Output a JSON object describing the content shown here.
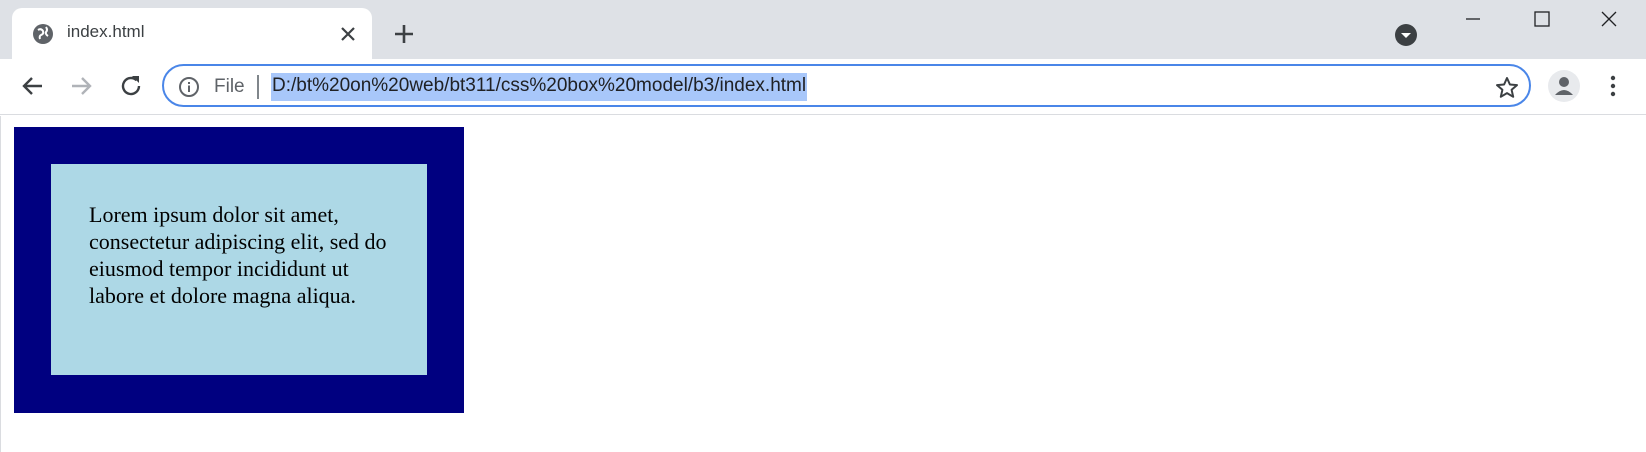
{
  "tab": {
    "title": "index.html",
    "favicon": "globe-icon",
    "close_icon": "close-icon"
  },
  "tabstrip": {
    "new_tab_icon": "plus-icon",
    "search_tabs_icon": "chevron-down-circle-icon"
  },
  "window_controls": {
    "minimize_icon": "minimize-icon",
    "maximize_icon": "maximize-icon",
    "close_icon": "close-icon"
  },
  "toolbar": {
    "back_icon": "arrow-left-icon",
    "forward_icon": "arrow-right-icon",
    "reload_icon": "reload-icon",
    "bookmark_icon": "star-icon",
    "profile_icon": "person-icon",
    "menu_icon": "kebab-menu-icon"
  },
  "omnibox": {
    "scheme_label": "File",
    "url": "D:/bt%20on%20web/bt311/css%20box%20model/b3/index.html",
    "info_icon": "info-icon"
  },
  "page": {
    "paragraph": "Lorem ipsum dolor sit amet, consectetur adipiscing elit, sed do eiusmod tempor incididunt ut labore et dolore magna aliqua."
  },
  "colors": {
    "outer_box": "#000080",
    "inner_box": "#add8e6",
    "url_highlight": "#a8c7fa",
    "focus_ring": "#4a86e8",
    "tabstrip": "#dee1e6"
  }
}
